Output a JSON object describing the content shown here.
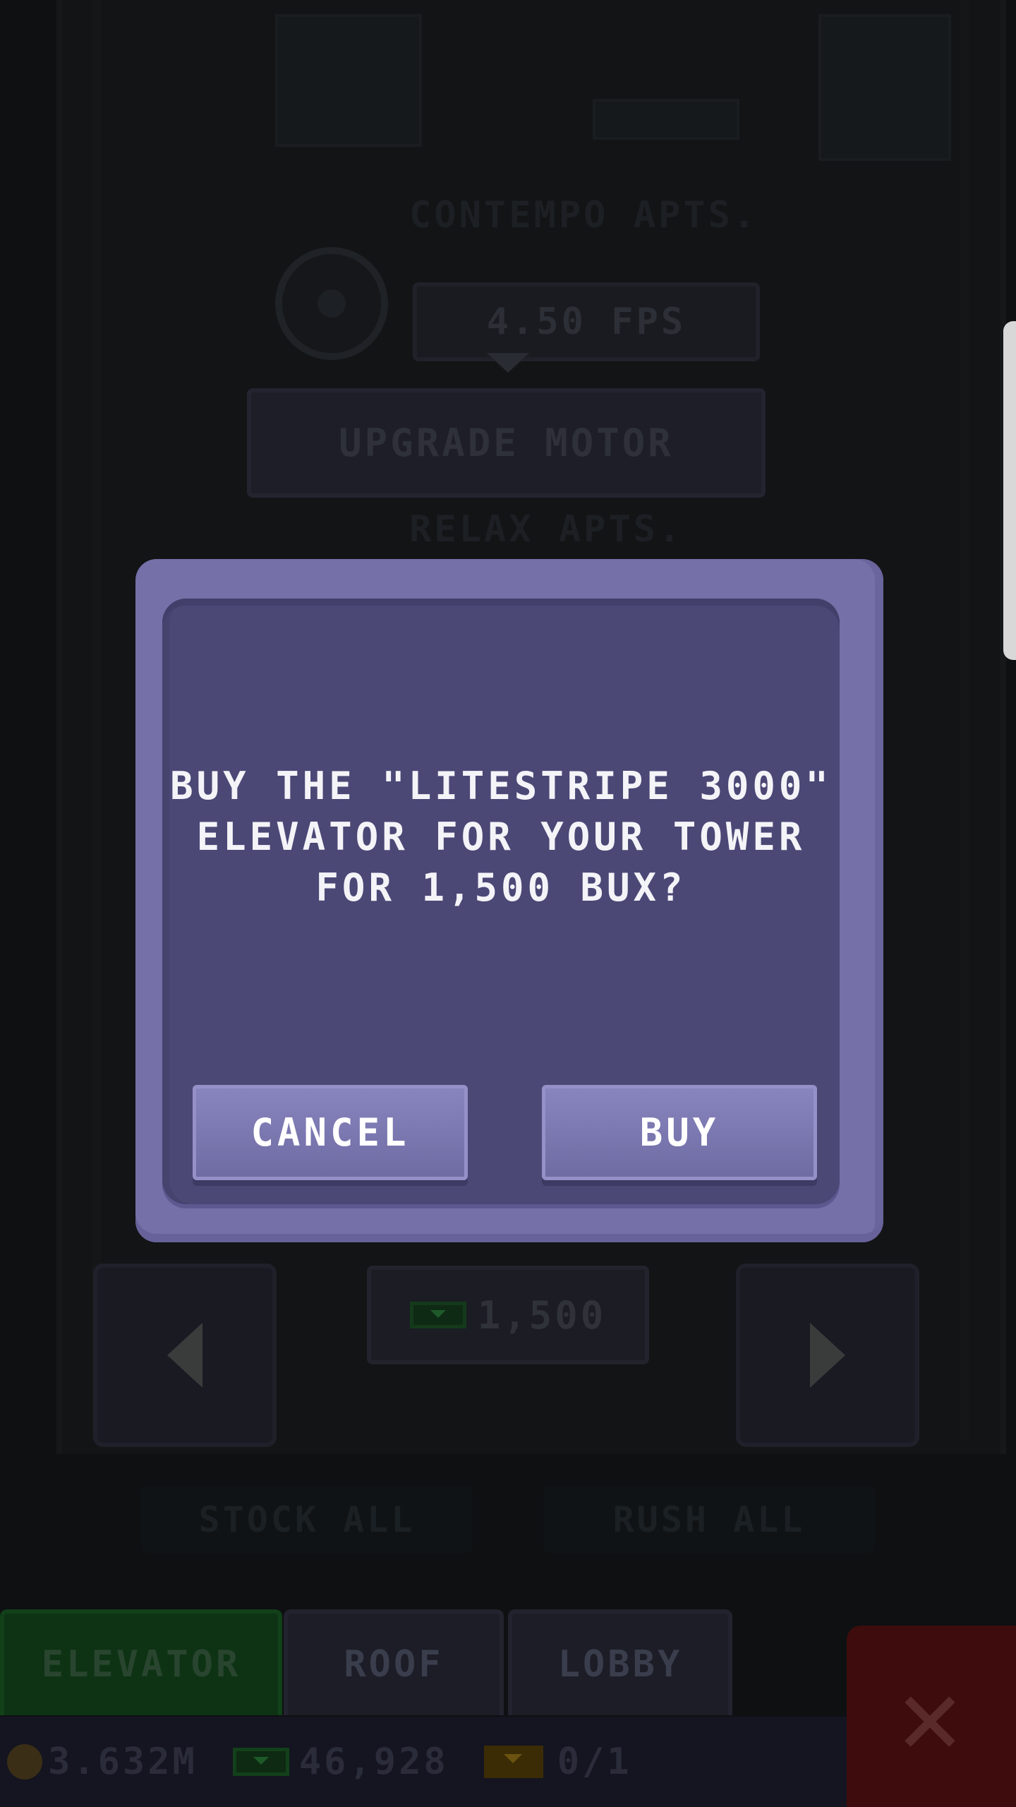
{
  "background": {
    "floor_top_label": "CONTEMPO APTS.",
    "floor_mid_label": "RELAX APTS.",
    "motor_speed": "4.50 FPS",
    "upgrade_button": "UPGRADE MOTOR",
    "elevator_price": "1,500",
    "stock_all_label": "STOCK ALL",
    "rush_all_label": "RUSH ALL"
  },
  "tabs": [
    {
      "label": "ELEVATOR",
      "active": true
    },
    {
      "label": "ROOF",
      "active": false
    },
    {
      "label": "LOBBY",
      "active": false
    }
  ],
  "status": {
    "coins": "3.632M",
    "bux": "46,928",
    "tickets": "0/1"
  },
  "dialog": {
    "message": "BUY THE \"LITESTRIPE 3000\"\nELEVATOR FOR YOUR TOWER\nFOR 1,500 BUX?",
    "cancel_label": "CANCEL",
    "buy_label": "BUY"
  },
  "colors": {
    "dialog_frame": "#7570a8",
    "dialog_panel": "#4b4876",
    "button": "#7e7ab3",
    "active_tab": "#0e3314",
    "close_button": "#3e0c0c"
  },
  "icons": [
    "motor-gear-icon",
    "arrow-left-icon",
    "arrow-right-icon",
    "bux-icon",
    "coin-icon",
    "ticket-icon",
    "close-icon"
  ]
}
